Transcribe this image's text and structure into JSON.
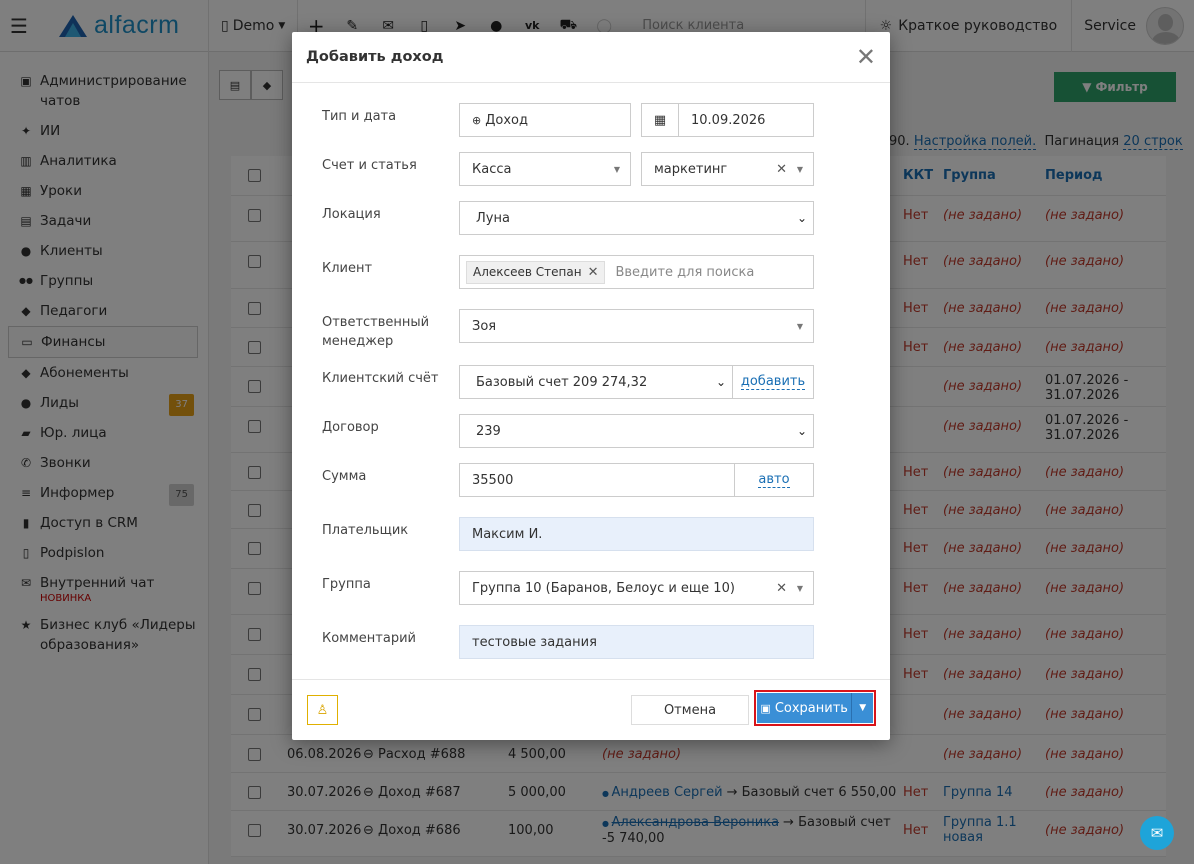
{
  "topbar": {
    "logo": "alfacrm",
    "branch": "Demo",
    "search_placeholder": "Поиск клиента",
    "guide": "Краткое руководство",
    "user": "Service"
  },
  "sidebar": {
    "items": [
      {
        "label": "Администрирование чатов",
        "icon": "chat-admin-icon"
      },
      {
        "label": "ИИ",
        "icon": "sparkle-icon"
      },
      {
        "label": "Аналитика",
        "icon": "analytics-icon"
      },
      {
        "label": "Уроки",
        "icon": "calendar-icon"
      },
      {
        "label": "Задачи",
        "icon": "tasks-icon"
      },
      {
        "label": "Клиенты",
        "icon": "user-icon"
      },
      {
        "label": "Группы",
        "icon": "users-icon"
      },
      {
        "label": "Педагоги",
        "icon": "graduation-cap-icon"
      },
      {
        "label": "Финансы",
        "icon": "money-icon"
      },
      {
        "label": "Абонементы",
        "icon": "tag-icon"
      },
      {
        "label": "Лиды",
        "icon": "lead-icon",
        "badge": "37"
      },
      {
        "label": "Юр. лица",
        "icon": "briefcase-icon"
      },
      {
        "label": "Звонки",
        "icon": "phone-icon"
      },
      {
        "label": "Информер",
        "icon": "list-icon",
        "badge": "75"
      },
      {
        "label": "Доступ в CRM",
        "icon": "lock-icon"
      },
      {
        "label": "Podpislon",
        "icon": "document-icon"
      },
      {
        "label": "Внутренний чат",
        "icon": "envelope-icon",
        "note": "НОВИНКА"
      },
      {
        "label": "Бизнес клуб «Лидеры образования»",
        "icon": "star-icon"
      }
    ]
  },
  "main": {
    "filter": "Фильтр",
    "meta_prefix": "90.",
    "meta_fields": "Настройка полей.",
    "meta_pagination": "Пагинация",
    "meta_rows": "20 строк",
    "headers": {
      "kkt": "ККТ",
      "group": "Группа",
      "period": "Период"
    },
    "rows": [
      {
        "kkt": "Нет",
        "group": "(не задано)",
        "period": "(не задано)"
      },
      {
        "kkt": "Нет",
        "group": "(не задано)",
        "period": "(не задано)"
      },
      {
        "kkt": "Нет",
        "group": "(не задано)",
        "period": "(не задано)"
      },
      {
        "kkt": "Нет",
        "group": "(не задано)",
        "period": "(не задано)"
      },
      {
        "kkt": "",
        "group": "(не задано)",
        "period": "01.07.2026 - 31.07.2026"
      },
      {
        "kkt": "",
        "group": "(не задано)",
        "period": "01.07.2026 - 31.07.2026"
      },
      {
        "kkt": "Нет",
        "group": "(не задано)",
        "period": "(не задано)"
      },
      {
        "kkt": "Нет",
        "group": "(не задано)",
        "period": "(не задано)"
      },
      {
        "kkt": "Нет",
        "group": "(не задано)",
        "period": "(не задано)"
      },
      {
        "kkt": "Нет",
        "group": "(не задано)",
        "period": "(не задано)"
      },
      {
        "kkt": "Нет",
        "group": "(не задано)",
        "period": "(не задано)"
      },
      {
        "kkt": "Нет",
        "group": "(не задано)",
        "period": "(не задано)"
      },
      {
        "kkt": "",
        "group": "(не задано)",
        "period": "(не задано)"
      }
    ],
    "visible_rows": [
      {
        "date": "06.08.2026",
        "doc": "Расход #688",
        "amount": "4 500,00",
        "desc": "(не задано)",
        "kkt": "",
        "group": "(не задано)",
        "period": "(не задано)"
      },
      {
        "date": "30.07.2026",
        "doc": "Доход #687",
        "amount": "5 000,00",
        "client": "Андреев Сергей",
        "arrow": "→ Базовый счет 6 550,00",
        "kkt": "Нет",
        "group": "Группа 14",
        "period": "(не задано)"
      },
      {
        "date": "30.07.2026",
        "doc": "Доход #686",
        "amount": "100,00",
        "client": "Александрова Вероника",
        "arrow": "→ Базовый счет",
        "arrow2": "-5 740,00",
        "kkt": "Нет",
        "group": "Группа 1.1",
        "group2": "новая",
        "period": "(не задано)"
      }
    ]
  },
  "modal": {
    "title": "Добавить доход",
    "labels": {
      "type_date": "Тип и дата",
      "account": "Счет и статья",
      "location": "Локация",
      "client": "Клиент",
      "manager": "Ответственный менеджер",
      "client_account": "Клиентский счёт",
      "contract": "Договор",
      "sum": "Сумма",
      "payer": "Плательщик",
      "group": "Группа",
      "comment": "Комментарий"
    },
    "values": {
      "type": "Доход",
      "date": "10.09.2026",
      "account": "Касса",
      "article": "маркетинг",
      "location": "Луна",
      "client_tag": "Алексеев Степан",
      "client_placeholder": "Введите для поиска",
      "manager": "Зоя",
      "client_account": "Базовый счет 209 274,32",
      "client_account_add": "добавить",
      "contract": "239",
      "sum": "35500",
      "sum_auto": "авто",
      "payer": "Максим И.",
      "group": "Группа 10 (Баранов, Белоус и еще 10)",
      "comment": "тестовые задания"
    },
    "buttons": {
      "cancel": "Отмена",
      "save": "Сохранить"
    }
  }
}
